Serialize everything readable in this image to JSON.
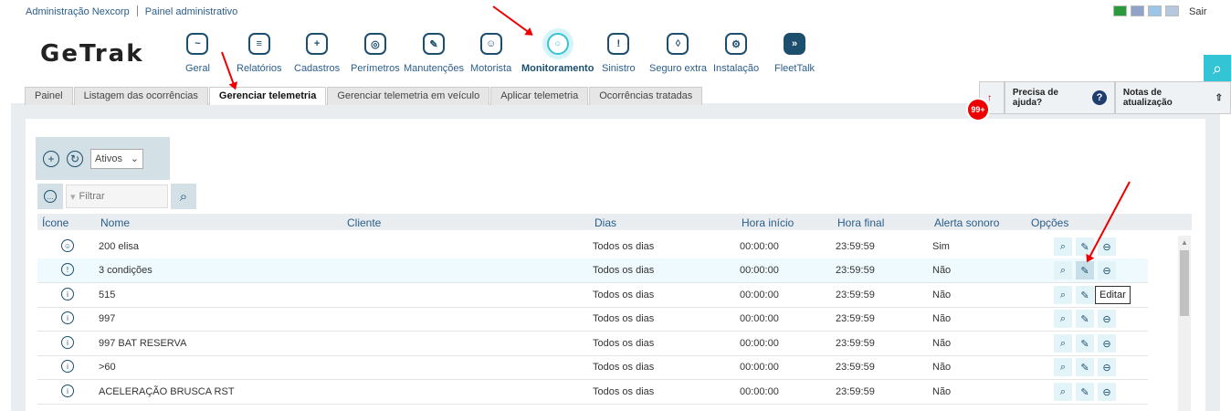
{
  "topbar": {
    "admin_link": "Administração Nexcorp",
    "panel_link": "Painel administrativo",
    "logout": "Sair"
  },
  "brand": {
    "logo": "GeTrak"
  },
  "nav": [
    {
      "label": "Geral",
      "icon": "monitor-icon"
    },
    {
      "label": "Relatórios",
      "icon": "report-icon"
    },
    {
      "label": "Cadastros",
      "icon": "folder-plus-icon"
    },
    {
      "label": "Perímetros",
      "icon": "perimeter-icon"
    },
    {
      "label": "Manutenções",
      "icon": "wrench-icon"
    },
    {
      "label": "Motorista",
      "icon": "driver-icon"
    },
    {
      "label": "Monitoramento",
      "icon": "monitoring-icon"
    },
    {
      "label": "Sinistro",
      "icon": "alarm-icon"
    },
    {
      "label": "Seguro extra",
      "icon": "shield-icon"
    },
    {
      "label": "Instalação",
      "icon": "install-icon"
    },
    {
      "label": "FleetTalk",
      "icon": "fleettalk-icon"
    }
  ],
  "tabs": [
    {
      "label": "Painel"
    },
    {
      "label": "Listagem das ocorrências"
    },
    {
      "label": "Gerenciar telemetria"
    },
    {
      "label": "Gerenciar telemetria em veículo"
    },
    {
      "label": "Aplicar telemetria"
    },
    {
      "label": "Ocorrências tratadas"
    }
  ],
  "help": {
    "need_help": "Precisa de ajuda?",
    "release_notes": "Notas de atualização",
    "badge": "99+"
  },
  "toolbar": {
    "status_select": "Ativos",
    "filter_placeholder": "Filtrar"
  },
  "table": {
    "columns": [
      "Ícone",
      "Nome",
      "Cliente",
      "Dias",
      "Hora início",
      "Hora final",
      "Alerta sonoro",
      "Opções"
    ],
    "rows": [
      {
        "name": "200 elisa",
        "client": "",
        "days": "Todos os dias",
        "start": "00:00:00",
        "end": "23:59:59",
        "sound": "Sim"
      },
      {
        "name": "3 condições",
        "client": "",
        "days": "Todos os dias",
        "start": "00:00:00",
        "end": "23:59:59",
        "sound": "Não"
      },
      {
        "name": "515",
        "client": "",
        "days": "Todos os dias",
        "start": "00:00:00",
        "end": "23:59:59",
        "sound": "Não"
      },
      {
        "name": "997",
        "client": "",
        "days": "Todos os dias",
        "start": "00:00:00",
        "end": "23:59:59",
        "sound": "Não"
      },
      {
        "name": "997 BAT RESERVA",
        "client": "",
        "days": "Todos os dias",
        "start": "00:00:00",
        "end": "23:59:59",
        "sound": "Não"
      },
      {
        "name": ">60",
        "client": "",
        "days": "Todos os dias",
        "start": "00:00:00",
        "end": "23:59:59",
        "sound": "Não"
      },
      {
        "name": "ACELERAÇÃO BRUSCA RST",
        "client": "",
        "days": "Todos os dias",
        "start": "00:00:00",
        "end": "23:59:59",
        "sound": "Não"
      }
    ]
  },
  "tooltip": "Editar",
  "colors": {
    "accent": "#33c4d6",
    "primary": "#1c4f6e",
    "arrow": "#e00000"
  }
}
